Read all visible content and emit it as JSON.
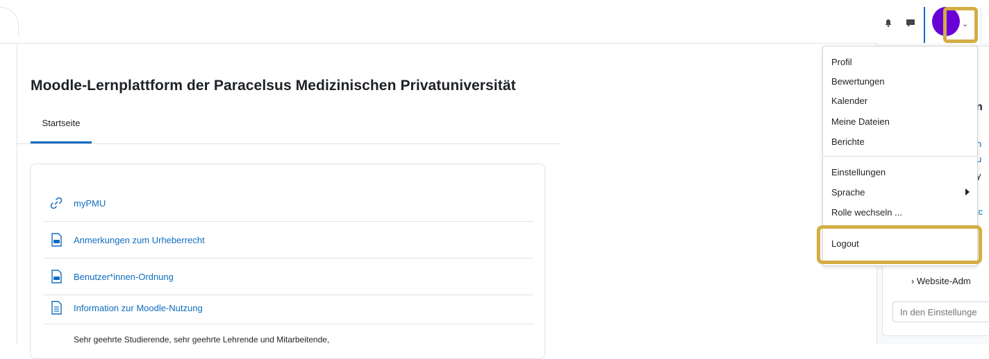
{
  "header": {
    "user_menu": {
      "items": [
        {
          "label": "Profil"
        },
        {
          "label": "Bewertungen"
        },
        {
          "label": "Kalender"
        },
        {
          "label": "Meine Dateien"
        },
        {
          "label": "Berichte"
        },
        {
          "label": "Einstellungen"
        },
        {
          "label": "Sprache"
        },
        {
          "label": "Rolle wechseln ..."
        },
        {
          "label": "Logout"
        }
      ]
    }
  },
  "page": {
    "title": "Moodle-Lernplattform der Paracelsus Medizinischen Privatuniversität",
    "tabs": [
      {
        "label": "Startseite"
      }
    ]
  },
  "activities": [
    {
      "label": "myPMU",
      "icon": "link-icon"
    },
    {
      "label": "Anmerkungen zum Urheberrecht",
      "icon": "pdf-icon"
    },
    {
      "label": "Benutzer*innen-Ordnung",
      "icon": "pdf-icon"
    },
    {
      "label": "Information zur Moodle-Nutzung",
      "icon": "document-icon"
    }
  ],
  "activity_description": "Sehr geehrte Studierende, sehr geehrte Lehrende und Mitarbeitende,",
  "drawer": {
    "fragments": [
      "n",
      "n",
      "u",
      "y",
      "tc"
    ],
    "admin_link": "Website-Adm",
    "search_placeholder": "In den Einstellunge"
  },
  "colors": {
    "accent": "#0f6cbf",
    "avatar": "#6a00d8",
    "highlight": "#d4ad44"
  }
}
